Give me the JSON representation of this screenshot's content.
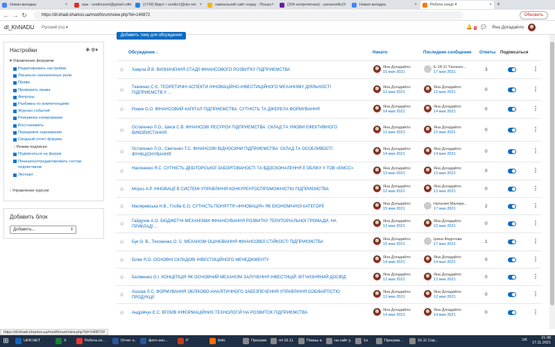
{
  "browser": {
    "tabs": [
      {
        "label": "Новая вкладка",
        "color": "#4285f4"
      },
      {
        "label": "ааа - svetlicwork@gmail.com - G",
        "color": "#d93025"
      },
      {
        "label": "(1743) Віднт • svetlic1@ukr.net",
        "color": "#1e88e5"
      },
      {
        "label": "навчальний сайт ендау - Пошук",
        "color": "#f4b400"
      },
      {
        "label": "(204 непрочитани) - yanasvetlicC",
        "color": "#6a1b9a"
      },
      {
        "label": "Новая вкладка",
        "color": "#4285f4"
      },
      {
        "label": "Робота секції 4",
        "color": "#f57c00"
      }
    ],
    "url": "https://dl.khadi.kharkov.ua/mod/forum/view.php?id=140872",
    "update_label": "Обновить",
    "status_url": "https://dl.khadi.kharkov.ua/mod/forum/view.php?id=140872#"
  },
  "header": {
    "site_name": "dl_KhNADU",
    "language": "Русский (ru) ▾",
    "user_name": "Яна Догадайло",
    "notification_count": "9"
  },
  "settings_block": {
    "title": "Настройки",
    "section_forum": "Управление форумом",
    "items": [
      "Редактировать настройки",
      "Локально назначенные роли",
      "Права",
      "Проверить права",
      "Фильтры",
      "Разбивка по компетенциям",
      "Журнал событий",
      "Резервное копирование",
      "Восстановить",
      "Передовое оценивание",
      "Сводный отчет форума"
    ],
    "subscription": "Режим подписки",
    "items2": [
      "Подписаться на форум",
      "Показать/отредактировать состав подписчиков",
      "Экспорт"
    ],
    "section_course": "Управление курсом"
  },
  "add_block": {
    "title": "Добавить блок",
    "select_value": "Добавить..."
  },
  "main": {
    "add_topic_label": "Добавить тему для обсуждения",
    "columns": {
      "discussion": "Обсуждение ↓",
      "started": "Начато",
      "last_post": "Последнее сообщение",
      "replies": "Ответы",
      "subscribe": "Подписаться"
    },
    "rows": [
      {
        "title": "Хавула Й.В. ВИЗНАЧЕННЯ СТАДІЇ ФІНАНСОВОГО РОЗВИТКУ ПІДПРИЄМСТВА",
        "starter": "Яна Догадайло",
        "start_date": "15 мая 2021",
        "last": "Е-18-11 Тихонен...",
        "last_date": "17 мая 2021",
        "replies": "3",
        "last_gray": true
      },
      {
        "title": "Ткаченко С.Є. ТЕОРЕТИЧНІ АСПЕКТИ ІННОВАЦІЙНО-ІНВЕСТИЦІЙНОГО МЕХАНІЗМУ ДІЯЛЬНОСТІ ПІДПРИЄМСТВ У ...",
        "starter": "Яна Догадайло",
        "start_date": "12 мая 2021",
        "last": "Яна Догадайло",
        "last_date": "12 мая 2021",
        "replies": "0",
        "last_gray": false
      },
      {
        "title": "Рожик О.О. ФІНАНСОВИЙ КАПІТАЛ ПІДПРИЄМСТВА: СУТНІСТЬ ТА ДЖЕРЕЛА ФОРМУВАННЯ",
        "starter": "Яна Догадайло",
        "start_date": "14 мая 2021",
        "last": "Яна Догадайло",
        "last_date": "14 мая 2021",
        "replies": "0",
        "last_gray": false
      },
      {
        "title": "Остапенко Л.О., Шисв С.В. ФІНАНСОВІ РЕСУРСИ ПІДПРИЄМСТВА: СКЛАД ТА УМОВИ ЕФЕКТИВНОГО ВИКОРИСТАННЯ",
        "starter": "Яна Догадайло",
        "start_date": "12 мая 2021",
        "last": "Яна Догадайло",
        "last_date": "12 мая 2021",
        "replies": "0",
        "last_gray": false
      },
      {
        "title": "Остапенко Л.О., Свитенко Т.С. ФІНАНСОВІ ВІДНОСИНИ ПІДПРИЄМСТВА: СКЛАД ТА ОСОБЛИВОСТІ ФУНКЦІОНУВАННЯ",
        "starter": "Яна Догадайло",
        "start_date": "14 мая 2021",
        "last": "Яна Догадайло",
        "last_date": "14 мая 2021",
        "replies": "0",
        "last_gray": false
      },
      {
        "title": "Насоненко Я.С. СУТНІСТЬ ДЕБІТОРСЬКОЇ ЗАБОРГОВАНОСТІ ТА ВДОСКОНАЛЕННЯ ЇЇ ОБЛІКУ У ТОВ «ЕМСС»",
        "starter": "Яна Догадайло",
        "start_date": "13 мая 2021",
        "last": "Яна Догадайло",
        "last_date": "13 мая 2021",
        "replies": "0",
        "last_gray": false
      },
      {
        "title": "Мороз А.Р. ІННОВАЦІЇ В СИСТЕМІ УПРАВЛІННЯ КОНКУРЕНТОСПРОМОЖНІСТЮ ПІДПРИЄМСТВА",
        "starter": "Яна Догадайло",
        "start_date": "12 мая 2021",
        "last": "Яна Догадайло",
        "last_date": "12 мая 2021",
        "replies": "0",
        "last_gray": false
      },
      {
        "title": "Маляревська Н.В., Глоба Є.О. СУТНІСТЬ ПОНЯТТЯ «ІННОВАЦІЯ» ЯК ЕКОНОМІЧНОЇ КАТЕГОРІЇ",
        "starter": "Яна Догадайло",
        "start_date": "15 мая 2021",
        "last": "Наталия Маляре...",
        "last_date": "17 мая 2021",
        "replies": "2",
        "last_gray": true
      },
      {
        "title": "Гайдучик А.О. БЮДЖЕТНІ МЕХАНІЗМИ ФІНАНСУВАННЯ РОЗВИТКУ ТЕРИТОРІАЛЬНОЇ ГРОМАДИ, НА ПРИКЛАДІ ...",
        "starter": "Яна Догадайло",
        "start_date": "12 мая 2021",
        "last": "Яна Догадайло",
        "last_date": "12 мая 2021",
        "replies": "0",
        "last_gray": false
      },
      {
        "title": "Бук О. В., Тихоненко О. С. МЕХАНІЗМ ОЦІНЮВАННЯ ФІНАНСОВОЇ СТІЙКОСТІ ПІДПРИЄМСТВА",
        "starter": "Яна Догадайло",
        "start_date": "15 мая 2021",
        "last": "Ірина Федотова",
        "last_date": "17 мая 2021",
        "replies": "1",
        "last_gray": true
      },
      {
        "title": "Білик Я.О. ОСНОВНІ СКЛАДОВІ ІНВЕСТИЦІЙНОГО МЕНЕДЖМЕНТУ",
        "starter": "Яна Догадайло",
        "start_date": "14 мая 2021",
        "last": "Яна Догадайло",
        "last_date": "14 мая 2021",
        "replies": "0",
        "last_gray": false
      },
      {
        "title": "Беліменко О.І. КОНЦЕПЦІЯ ЯК ОСНОВНИЙ МЕХАНІЗМ ЗАЛУЧЕННЯ ІНВЕСТИЦІЙ: ВІТЧИЗНЯНИЙ ДОСВІД",
        "starter": "Яна Догадайло",
        "start_date": "12 мая 2021",
        "last": "Яна Догадайло",
        "last_date": "12 мая 2021",
        "replies": "0",
        "last_gray": false
      },
      {
        "title": "Асєєва Л.С. ФОРМУВАННЯ ОБЛІКОВО-АНАЛІТИЧНОГО ЗАБЕЗПЕЧЕННЯ УПРАВЛІННЯ СОБІВАРТІСТЮ ПРОДУКЦІЇ",
        "starter": "Яна Догадайло",
        "start_date": "12 мая 2021",
        "last": "Яна Догадайло",
        "last_date": "12 мая 2021",
        "replies": "0",
        "last_gray": false
      },
      {
        "title": "Андрійчук Є.С. ВПЛИВ ІНФОРМАЦІЙНИХ ТЕХНОЛОГІЙ НА РОЗВИТОК ПІДПРИЄМСТВА",
        "starter": "Яна Догадайло",
        "start_date": "14 мая 2021",
        "last": "Яна Догадайло",
        "last_date": "14 мая 2021",
        "replies": "0",
        "last_gray": false
      }
    ]
  },
  "taskbar": {
    "items": [
      {
        "label": "UKR.NET",
        "color": "#1565c0"
      },
      {
        "label": "X",
        "color": "#1e7e34"
      },
      {
        "label": "Робота се...",
        "color": "#e53935"
      },
      {
        "label": "Отчет о...",
        "color": "#2b579a"
      },
      {
        "label": "фото кон...",
        "color": "#2b579a"
      },
      {
        "label": "P",
        "color": "#c43e1c"
      },
      {
        "label": "tinfo",
        "color": "#ff6d00"
      },
      {
        "label": "Програм...",
        "color": "#888888"
      },
      {
        "label": "ml 16.11",
        "color": "#888888"
      },
      {
        "label": "Планы ка...",
        "color": "#888888"
      },
      {
        "label": "на сайт у...",
        "color": "#888888"
      },
      {
        "label": "1л",
        "color": "#888888"
      },
      {
        "label": "Програм...",
        "color": "#888888"
      },
      {
        "label": "16.11 Сор...",
        "color": "#888888"
      }
    ],
    "lang": "UK",
    "time": "21:38",
    "date": "17.11.2021"
  }
}
